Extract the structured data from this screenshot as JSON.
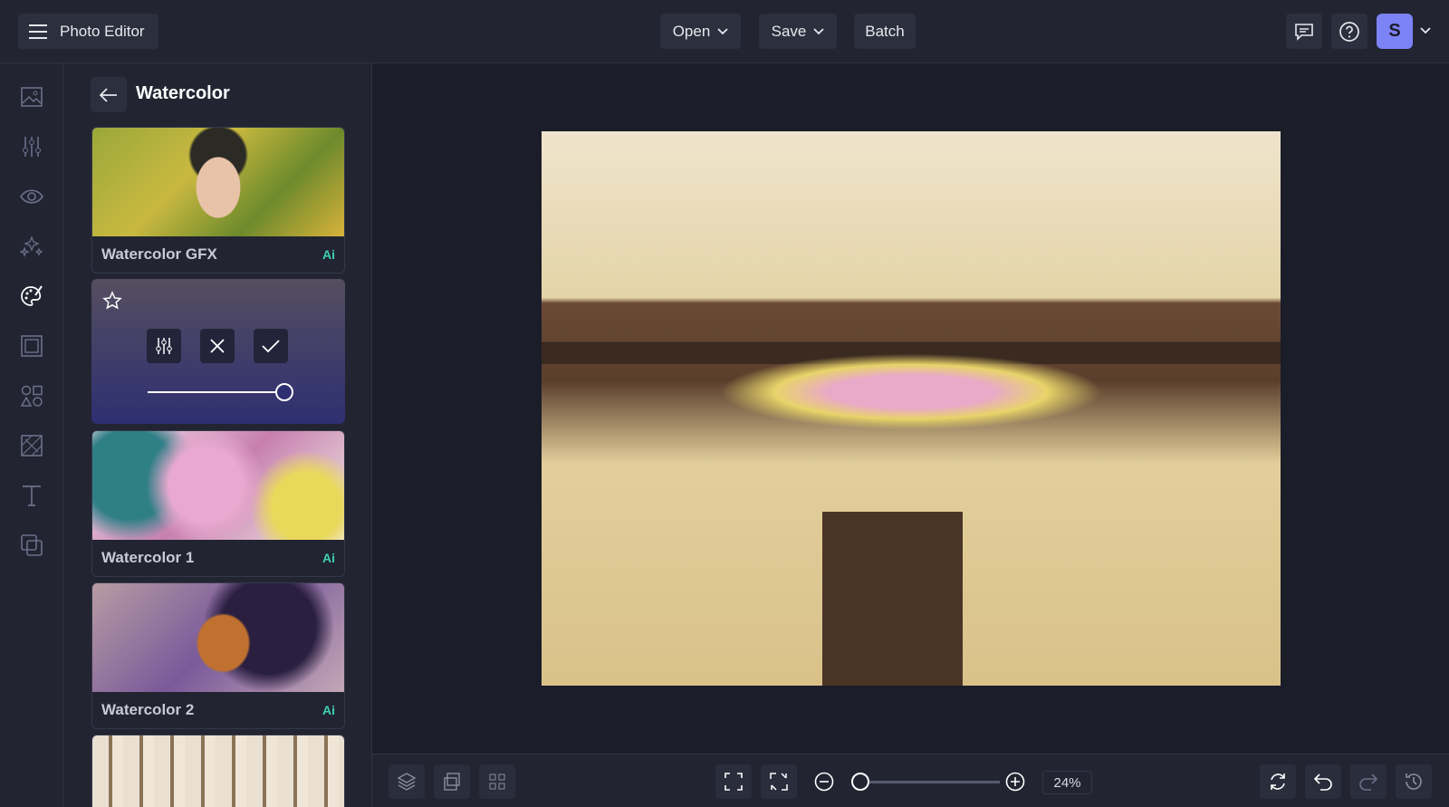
{
  "header": {
    "app_title": "Photo Editor",
    "open_label": "Open",
    "save_label": "Save",
    "batch_label": "Batch",
    "avatar_initial": "S"
  },
  "panel": {
    "title": "Watercolor",
    "items": [
      {
        "label": "Watercolor GFX",
        "badge": "Ai"
      },
      {
        "label": "Watercolor 1",
        "badge": "Ai"
      },
      {
        "label": "Watercolor 2",
        "badge": "Ai"
      }
    ],
    "active_intensity": 1.0
  },
  "bottom": {
    "zoom_value": "24%",
    "zoom_slider": 0.0
  },
  "colors": {
    "accent": "#7c83f5",
    "ai_badge": "#3fd0b3",
    "background": "#1b1d29"
  }
}
